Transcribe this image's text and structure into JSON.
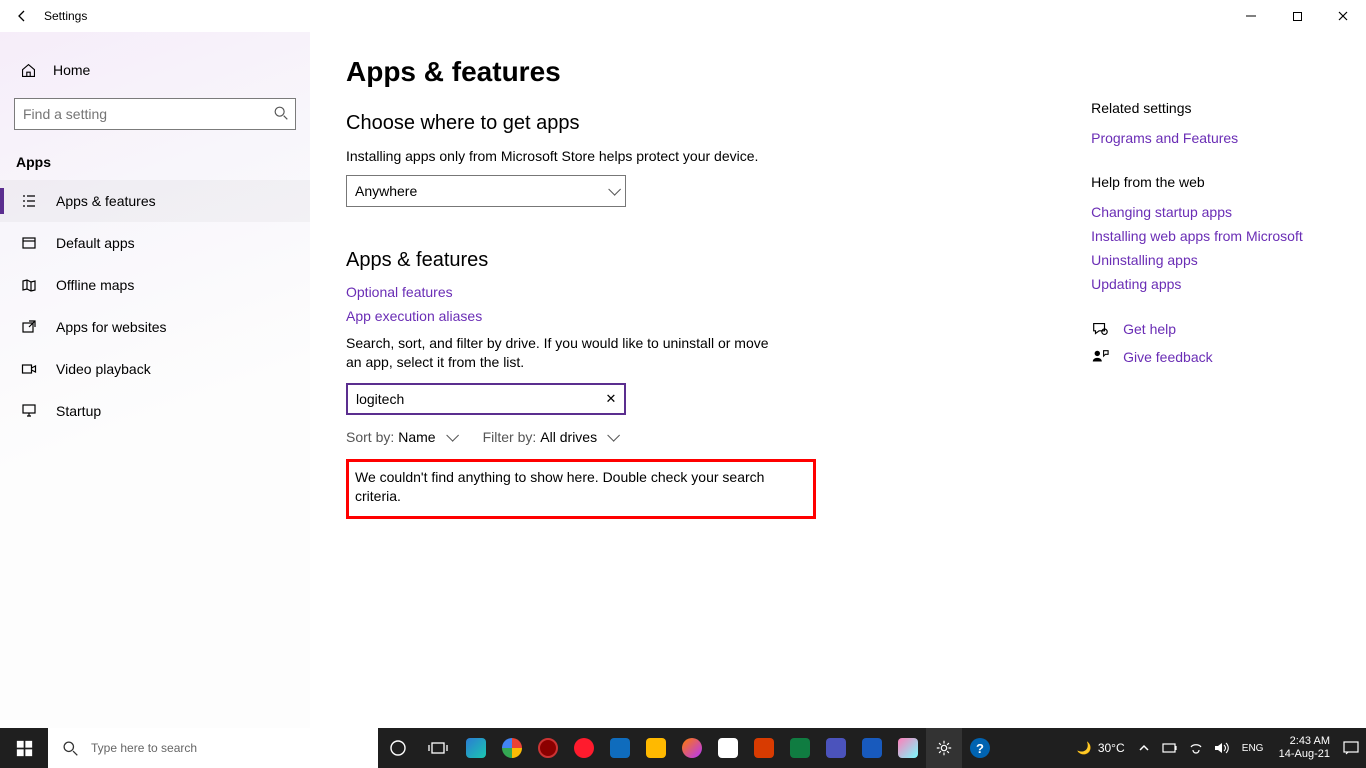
{
  "window": {
    "title": "Settings"
  },
  "sidebar": {
    "home": "Home",
    "search_placeholder": "Find a setting",
    "category": "Apps",
    "items": [
      {
        "label": "Apps & features"
      },
      {
        "label": "Default apps"
      },
      {
        "label": "Offline maps"
      },
      {
        "label": "Apps for websites"
      },
      {
        "label": "Video playback"
      },
      {
        "label": "Startup"
      }
    ]
  },
  "main": {
    "page_title": "Apps & features",
    "section1_title": "Choose where to get apps",
    "section1_text": "Installing apps only from Microsoft Store helps protect your device.",
    "source_selected": "Anywhere",
    "section2_title": "Apps & features",
    "link_optional": "Optional features",
    "link_aliases": "App execution aliases",
    "filter_text": "Search, sort, and filter by drive. If you would like to uninstall or move an app, select it from the list.",
    "search_value": "logitech",
    "sort_label": "Sort by:",
    "sort_value": "Name",
    "filter_label": "Filter by:",
    "filter_value": "All drives",
    "no_result": "We couldn't find anything to show here. Double check your search criteria."
  },
  "right": {
    "related_head": "Related settings",
    "related_link": "Programs and Features",
    "help_head": "Help from the web",
    "help_links": [
      "Changing startup apps",
      "Installing web apps from Microsoft",
      "Uninstalling apps",
      "Updating apps"
    ],
    "get_help": "Get help",
    "feedback": "Give feedback"
  },
  "taskbar": {
    "search_placeholder": "Type here to search",
    "weather_temp": "30°C",
    "clock_time": "2:43 AM",
    "clock_date": "14-Aug-21"
  }
}
